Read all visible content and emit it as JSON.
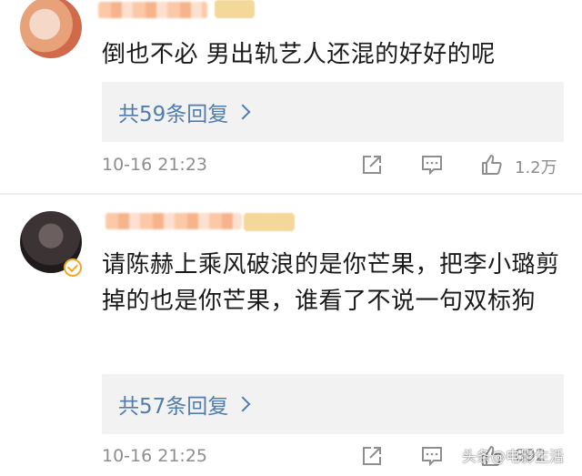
{
  "comments": [
    {
      "text": "倒也不必 男出轨艺人还混的好好的呢",
      "replies_label": "共59条回复",
      "time": "10-16 21:23",
      "likes": "1.2万"
    },
    {
      "text": "请陈赫上乘风破浪的是你芒果，把李小璐剪掉的也是你芒果，谁看了不说一句双标狗",
      "replies_label": "共57条回复",
      "time": "10-16 21:25",
      "likes": "892"
    }
  ],
  "watermark": "头条@电影生活",
  "colors": {
    "reply_link": "#507daf",
    "meta_text": "#8e8e8e",
    "reply_bg": "#f2f2f2",
    "verified": "#f5a623"
  },
  "icons": [
    "share-icon",
    "comment-icon",
    "like-icon",
    "chevron-right-icon",
    "verified-badge-icon"
  ]
}
